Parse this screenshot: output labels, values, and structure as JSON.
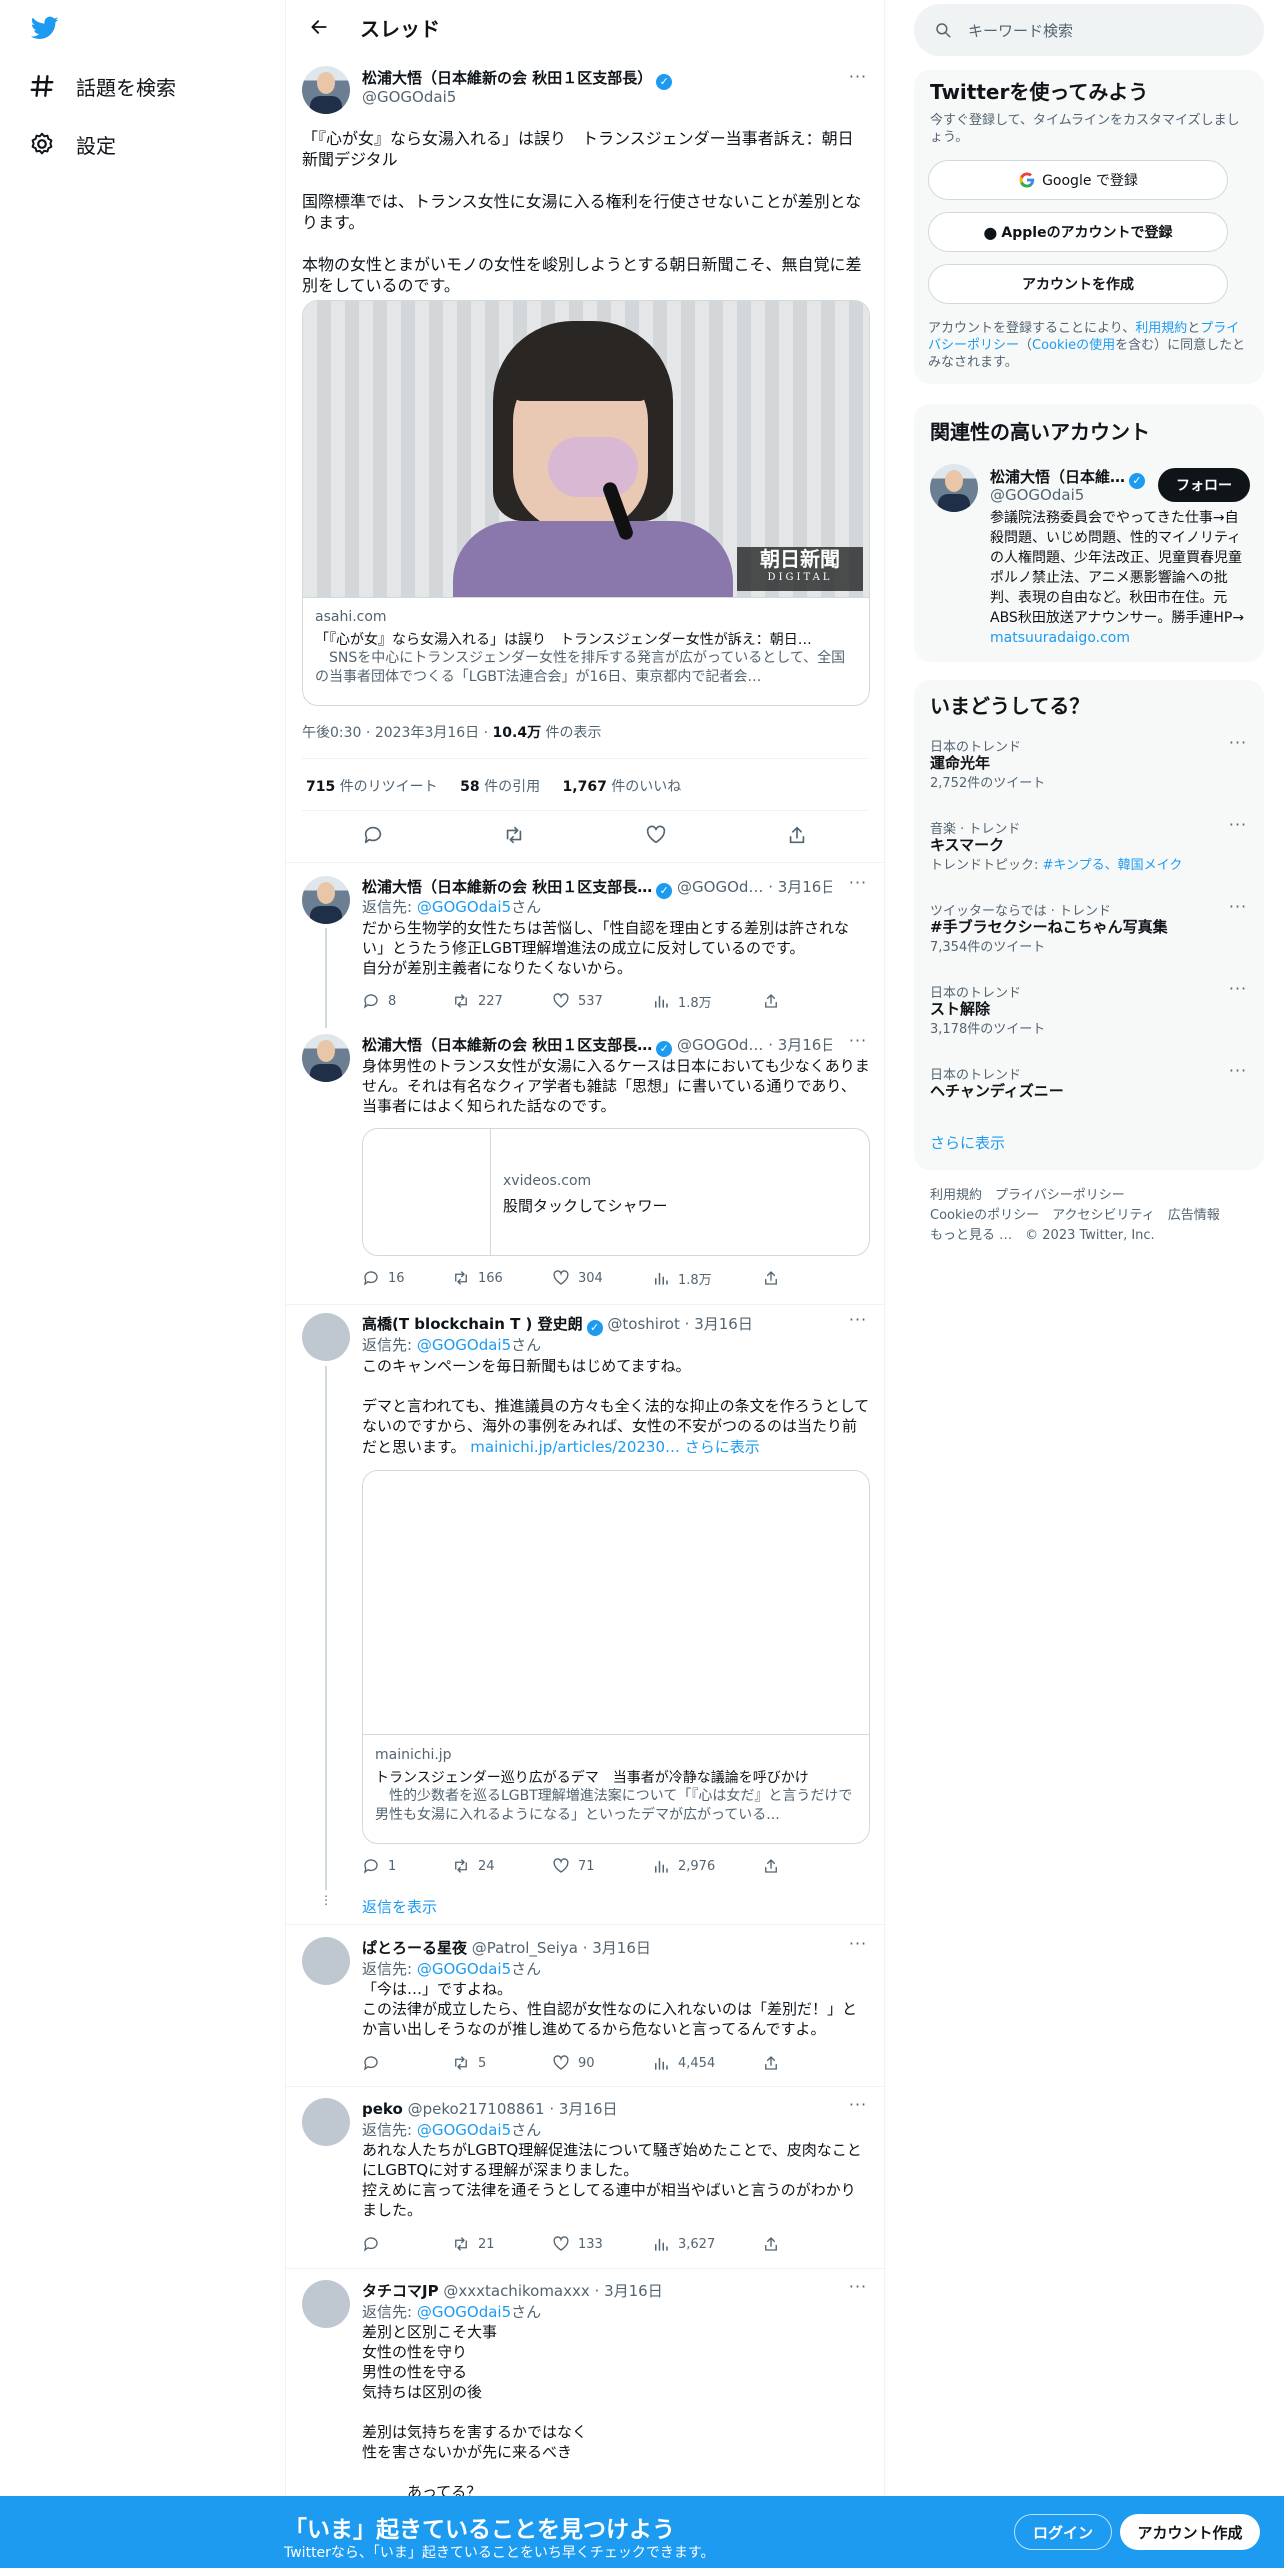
{
  "nav": {
    "explore": "話題を検索",
    "settings": "設定"
  },
  "header": {
    "title": "スレッド"
  },
  "main_tweet": {
    "name": "松浦大悟（日本維新の会 秋田１区支部長）",
    "handle": "@GOGOdai5",
    "text": "「『心が女』なら女湯入れる」は誤り　トランスジェンダー当事者訴え：朝日新聞デジタル\n\n国際標準では、トランス女性に女湯に入る権利を行使させないことが差別となります。\n\n本物の女性とまがいモノの女性を峻別しようとする朝日新聞こそ、無自覚に差別をしているのです。",
    "card": {
      "logo": "朝日新聞",
      "logo_sub": "DIGITAL",
      "domain": "asahi.com",
      "title": "「『心が女』なら女湯入れる」は誤り　トランスジェンダー女性が訴え：朝日…",
      "desc": "　SNSを中心にトランスジェンダー女性を排斥する発言が広がっているとして、全国の当事者団体でつくる「LGBT法連合会」が16日、東京都内で記者会…"
    },
    "time": "午後0:30",
    "date": "2023年3月16日",
    "views_num": "10.4万",
    "views_label": "件の表示",
    "retweets_num": "715",
    "retweets_label": "件のリツイート",
    "quotes_num": "58",
    "quotes_label": "件の引用",
    "likes_num": "1,767",
    "likes_label": "件のいいね"
  },
  "replies": [
    {
      "name": "松浦大悟（日本維新の会 秋田１区支部長…",
      "handle": "@GOGOd…",
      "date": "· 3月16日",
      "reply_prefix": "返信先: ",
      "reply_to": "@GOGOdai5",
      "reply_suffix": "さん",
      "text": "だから生物学的女性たちは苦悩し、「性自認を理由とする差別は許されない」とうたう修正LGBT理解増進法の成立に反対しているのです。\n自分が差別主義者になりたくないから。",
      "stats": {
        "reply": "8",
        "retweet": "227",
        "like": "537",
        "views": "1.8万"
      }
    },
    {
      "name": "松浦大悟（日本維新の会 秋田１区支部長…",
      "handle": "@GOGOd…",
      "date": "· 3月16日",
      "text": "身体男性のトランス女性が女湯に入るケースは日本においても少なくありません。それは有名なクィア学者も雑誌「思想」に書いている通りであり、当事者にはよく知られた話なのです。",
      "card": {
        "domain": "xvideos.com",
        "title": "股間タックしてシャワー"
      },
      "stats": {
        "reply": "16",
        "retweet": "166",
        "like": "304",
        "views": "1.8万"
      }
    },
    {
      "name": "高橋(T blockchain T ) 登史朗",
      "handle": "@toshirot",
      "date": "· 3月16日",
      "reply_prefix": "返信先: ",
      "reply_to": "@GOGOdai5",
      "reply_suffix": "さん",
      "text": "このキャンペーンを毎日新聞もはじめてますね。\n\nデマと言われても、推進議員の方々も全く法的な抑止の条文を作ろうとしてないのですから、海外の事例をみれば、女性の不安がつのるのは当たり前だと思います。",
      "link": "mainichi.jp/articles/20230…",
      "show_more": "さらに表示",
      "card": {
        "domain": "mainichi.jp",
        "title": "トランスジェンダー巡り広がるデマ　当事者が冷静な議論を呼びかけ",
        "desc": "　性的少数者を巡るLGBT理解増進法案について「『心は女だ』と言うだけで男性も女湯に入れるようになる」といったデマが広がっている..."
      },
      "stats": {
        "reply": "1",
        "retweet": "24",
        "like": "71",
        "views": "2,976"
      }
    },
    {
      "name": "ぱとろーる星夜",
      "handle": "@Patrol_Seiya",
      "date": "· 3月16日",
      "reply_prefix": "返信先: ",
      "reply_to": "@GOGOdai5",
      "reply_suffix": "さん",
      "text": "「今は…」ですよね。\nこの法律が成立したら、性自認が女性なのに入れないのは「差別だ！」とか言い出しそうなのが推し進めてるから危ないと言ってるんですよ。",
      "stats": {
        "reply": "",
        "retweet": "5",
        "like": "90",
        "views": "4,454"
      }
    },
    {
      "name": "peko",
      "handle": "@peko217108861",
      "date": "· 3月16日",
      "reply_prefix": "返信先: ",
      "reply_to": "@GOGOdai5",
      "reply_suffix": "さん",
      "text": "あれな人たちがLGBTQ理解促進法について騒ぎ始めたことで、皮肉なことにLGBTQに対する理解が深まりました。\n控えめに言って法律を通そうとしてる連中が相当やばいと言うのがわかりました。",
      "stats": {
        "reply": "",
        "retweet": "21",
        "like": "133",
        "views": "3,627"
      }
    },
    {
      "name": "タチコマJP",
      "handle": "@xxxtachikomaxxx",
      "date": "· 3月16日",
      "reply_prefix": "返信先: ",
      "reply_to": "@GOGOdai5",
      "reply_suffix": "さん",
      "text": "差別と区別こそ大事\n女性の性を守り\n男性の性を守る\n気持ちは区別の後\n\n差別は気持ちを害するかではなく\n性を害さないかが先に来るべき\n\n　　　あってる？"
    }
  ],
  "show_replies": "返信を表示",
  "search": {
    "placeholder": "キーワード検索"
  },
  "signup": {
    "title": "Twitterを使ってみよう",
    "subtitle": "今すぐ登録して、タイムラインをカスタマイズしましょう。",
    "google": "Google で登録",
    "apple": "Appleのアカウントで登録",
    "create": "アカウントを作成",
    "terms_1": "アカウントを登録することにより、",
    "terms_link1": "利用規約",
    "terms_2": "と",
    "terms_link2": "プライバシーポリシー",
    "terms_3": "（",
    "terms_link3": "Cookieの使用",
    "terms_4": "を含む）に同意したとみなされます。"
  },
  "related": {
    "title": "関連性の高いアカウント",
    "name": "松浦大悟（日本維…",
    "handle": "@GOGOdai5",
    "follow": "フォロー",
    "bio": "参議院法務委員会でやってきた仕事→自殺問題、いじめ問題、性的マイノリティの人権問題、少年法改正、児童買春児童ポルノ禁止法、アニメ悪影響論への批判、表現の自由など。秋田市在住。元ABS秋田放送アナウンサー。勝手連HP→ ",
    "bio_link": "matsuuradaigo.com"
  },
  "trends": {
    "title": "いまどうしてる？",
    "items": [
      {
        "category": "日本のトレンド",
        "name": "運命光年",
        "count": "2,752件のツイート"
      },
      {
        "category": "音楽 · トレンド",
        "name": "キスマーク",
        "topic_label": "トレンドトピック: ",
        "topic": "#キンプる、韓国メイク"
      },
      {
        "category": "ツイッターならでは · トレンド",
        "name": "#手ブラセクシーねこちゃん写真集",
        "count": "7,354件のツイート"
      },
      {
        "category": "日本のトレンド",
        "name": "スト解除",
        "count": "3,178件のツイート"
      },
      {
        "category": "日本のトレンド",
        "name": "ヘチャンディズニー"
      }
    ],
    "show_more": "さらに表示"
  },
  "footer": {
    "links": [
      "利用規約",
      "プライバシーポリシー",
      "Cookieのポリシー",
      "アクセシビリティ",
      "広告情報",
      "もっと見る …"
    ],
    "copyright": "© 2023 Twitter, Inc."
  },
  "banner": {
    "title": "「いま」起きていることを見つけよう",
    "subtitle": "Twitterなら、「いま」起きていることをいち早くチェックできます。",
    "login": "ログイン",
    "signup": "アカウント作成"
  },
  "colors": {
    "accent": "#1d9bf0",
    "text": "#0f1419",
    "muted": "#536471"
  }
}
